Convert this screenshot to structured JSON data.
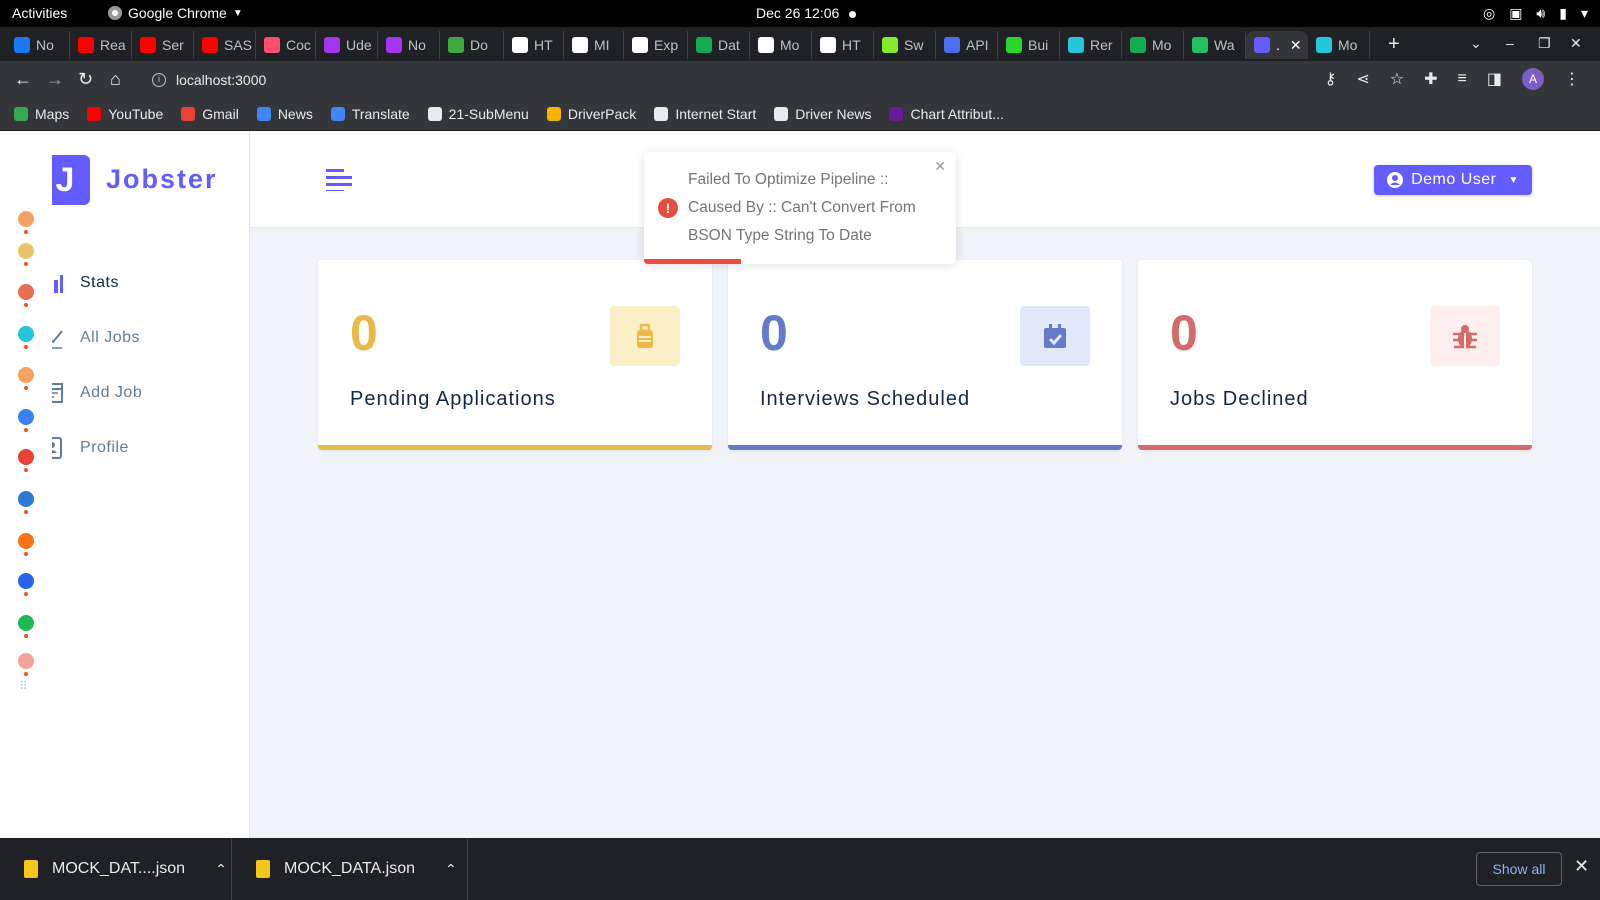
{
  "system_bar": {
    "activities": "Activities",
    "app_name": "Google Chrome",
    "clock": "Dec 26  12:06"
  },
  "browser": {
    "tabs": [
      {
        "label": "No",
        "color": "#1877f2"
      },
      {
        "label": "Rea",
        "color": "#ff0000"
      },
      {
        "label": "Ser",
        "color": "#ff0000"
      },
      {
        "label": "SAS",
        "color": "#ff0000"
      },
      {
        "label": "Coc",
        "color": "#ff4d6d"
      },
      {
        "label": "Ude",
        "color": "#a435f0"
      },
      {
        "label": "No",
        "color": "#a435f0"
      },
      {
        "label": "Do",
        "color": "#3ca93c"
      },
      {
        "label": "HT",
        "color": "#ffffff"
      },
      {
        "label": "MI",
        "color": "#ffffff"
      },
      {
        "label": "Exp",
        "color": "#ffffff"
      },
      {
        "label": "Dat",
        "color": "#13aa52"
      },
      {
        "label": "Mo",
        "color": "#ffffff"
      },
      {
        "label": "HT",
        "color": "#ffffff"
      },
      {
        "label": "Sw",
        "color": "#85ea2d"
      },
      {
        "label": "API",
        "color": "#4c6ef5"
      },
      {
        "label": "Bui",
        "color": "#2bd62b"
      },
      {
        "label": "Rer",
        "color": "#26c6da"
      },
      {
        "label": "Mo",
        "color": "#13aa52"
      },
      {
        "label": "Wa",
        "color": "#21c25e"
      },
      {
        "label": ".",
        "color": "#645cff",
        "active": true
      },
      {
        "label": "Mo",
        "color": "#26c6da"
      }
    ],
    "url": "localhost:3000",
    "profile_initial": "A",
    "bookmarks": [
      {
        "label": "Maps",
        "color": "#34a853"
      },
      {
        "label": "YouTube",
        "color": "#ff0000"
      },
      {
        "label": "Gmail",
        "color": "#ea4335"
      },
      {
        "label": "News",
        "color": "#4285f4"
      },
      {
        "label": "Translate",
        "color": "#4285f4"
      },
      {
        "label": "21-SubMenu",
        "color": "#e8eaed"
      },
      {
        "label": "DriverPack",
        "color": "#f4b400"
      },
      {
        "label": "Internet Start",
        "color": "#e8eaed"
      },
      {
        "label": "Driver News",
        "color": "#e8eaed"
      },
      {
        "label": "Chart Attribut...",
        "color": "#6a1b9a"
      }
    ]
  },
  "app": {
    "logo_letter": "J",
    "logo_text": "Jobster",
    "brand_color": "#645cff",
    "nav": [
      {
        "label": "Stats",
        "icon": "stats-icon",
        "active": true
      },
      {
        "label": "All Jobs",
        "icon": "all-jobs-icon",
        "active": false
      },
      {
        "label": "Add Job",
        "icon": "add-job-icon",
        "active": false
      },
      {
        "label": "Profile",
        "icon": "profile-icon",
        "active": false
      }
    ],
    "user_button": "Demo User",
    "stats": [
      {
        "count": "0",
        "label": "Pending Applications",
        "color": "#e9b949",
        "bg": "#fcefc7",
        "icon": "suitcase-icon"
      },
      {
        "count": "0",
        "label": "Interviews Scheduled",
        "color": "#647acb",
        "bg": "#e0e8f9",
        "icon": "calendar-check-icon"
      },
      {
        "count": "0",
        "label": "Jobs Declined",
        "color": "#d66a6a",
        "bg": "#ffeeee",
        "icon": "bug-icon"
      }
    ],
    "toast": {
      "message": "Failed To Optimize Pipeline :: Caused By :: Can't Convert From BSON Type String To Date",
      "progress": 0.31
    }
  },
  "downloads": {
    "items": [
      "MOCK_DAT....json",
      "MOCK_DATA.json"
    ],
    "show_all": "Show all"
  }
}
